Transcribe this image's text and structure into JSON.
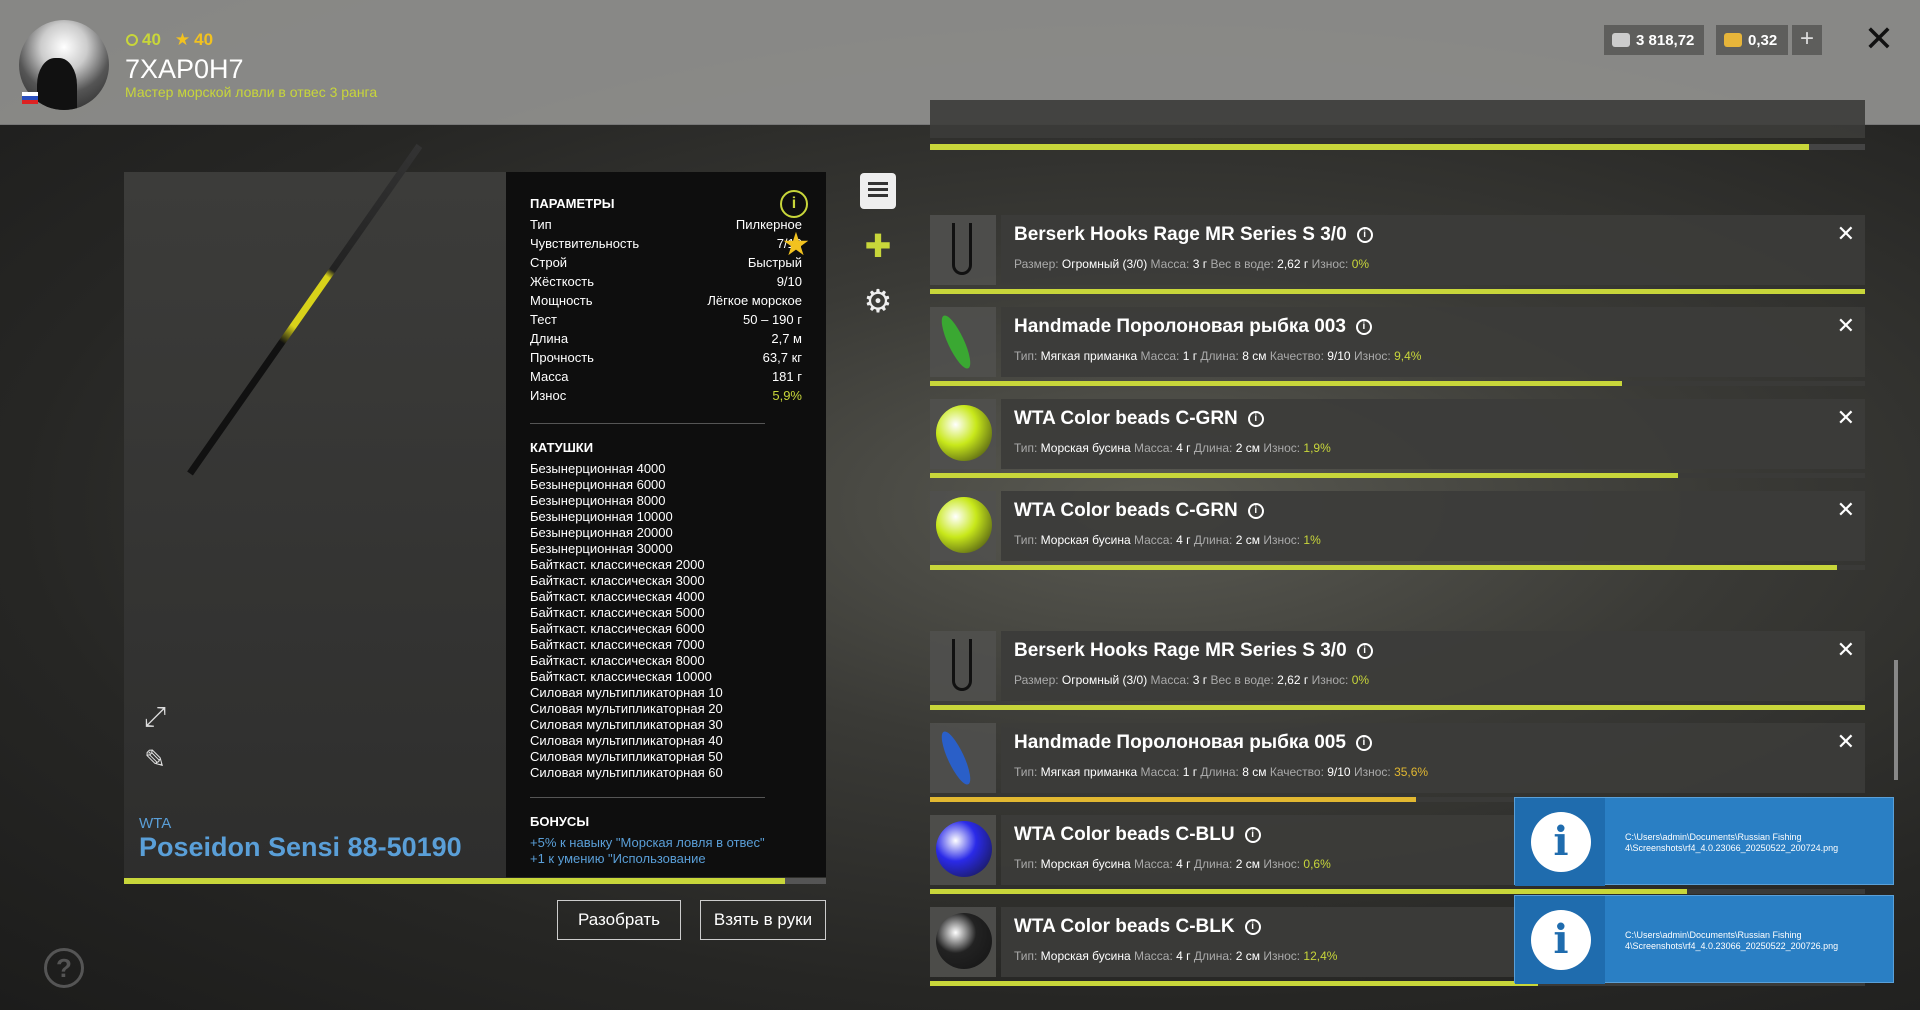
{
  "header": {
    "level_silver": "40",
    "level_gold": "40",
    "player_name": "7XAP0H7",
    "player_rank": "Мастер морской ловли в отвес 3 ранга",
    "silver_amount": "3 818,72",
    "gold_amount": "0,32",
    "plus_label": "+",
    "close_label": "✕"
  },
  "rod": {
    "brand": "WTA",
    "name": "Poseidon Sensi 88-50190",
    "wear_fraction": 0.941,
    "params_title": "ПАРАМЕТРЫ",
    "params": [
      {
        "label": "Тип",
        "value": "Пилкерное"
      },
      {
        "label": "Чувствительность",
        "value": "7/10"
      },
      {
        "label": "Строй",
        "value": "Быстрый"
      },
      {
        "label": "Жёсткость",
        "value": "9/10"
      },
      {
        "label": "Мощность",
        "value": "Лёгкое морское"
      },
      {
        "label": "Тест",
        "value": "50 – 190 г"
      },
      {
        "label": "Длина",
        "value": "2,7 м"
      },
      {
        "label": "Прочность",
        "value": "63,7 кг"
      },
      {
        "label": "Масса",
        "value": "181 г"
      },
      {
        "label": "Износ",
        "value": "5,9%"
      }
    ],
    "reels_title": "КАТУШКИ",
    "reels": [
      "Безынерционная 4000",
      "Безынерционная 6000",
      "Безынерционная 8000",
      "Безынерционная 10000",
      "Безынерционная 20000",
      "Безынерционная 30000",
      "Байткаст. классическая 2000",
      "Байткаст. классическая 3000",
      "Байткаст. классическая 4000",
      "Байткаст. классическая 5000",
      "Байткаст. классическая 6000",
      "Байткаст. классическая 7000",
      "Байткаст. классическая 8000",
      "Байткаст. классическая 10000",
      "Силовая мультипликаторная 10",
      "Силовая мультипликаторная 20",
      "Силовая мультипликаторная 30",
      "Силовая мультипликаторная 40",
      "Силовая мультипликаторная 50",
      "Силовая мультипликаторная 60"
    ],
    "bonuses_title": "БОНУСЫ",
    "bonuses": [
      "+5% к навыку \"Морская ловля в отвес\"",
      "+1 к умению \"Использование"
    ]
  },
  "buttons": {
    "dismantle": "Разобрать",
    "equip": "Взять в руки"
  },
  "top_item": {
    "details": "Тип: Морская бусина  Масса: 4 г  Длина: 2 см  Износ: 0,6%",
    "wear_fraction": 0.94
  },
  "items": [
    {
      "title": "Berserk Hooks Rage MR Series S 3/0",
      "kind": "hook",
      "details": [
        {
          "label": "Размер:",
          "value": "Огромный (3/0)"
        },
        {
          "label": "Масса:",
          "value": "3 г"
        },
        {
          "label": "Вес в воде:",
          "value": "2,62 г"
        },
        {
          "label": "Износ:",
          "value": "0%",
          "wear": true
        }
      ],
      "wear_fraction": 1.0,
      "wear_color": "#c8d63a"
    },
    {
      "title": "Handmade Поролоновая рыбка 003",
      "kind": "lure",
      "lure_color": "#3aa832",
      "details": [
        {
          "label": "Тип:",
          "value": "Мягкая приманка"
        },
        {
          "label": "Масса:",
          "value": "1 г"
        },
        {
          "label": "Длина:",
          "value": "8 см"
        },
        {
          "label": "Качество:",
          "value": "9/10"
        },
        {
          "label": "Износ:",
          "value": "9,4%",
          "wear": true
        }
      ],
      "wear_fraction": 0.74,
      "wear_color": "#c8d63a"
    },
    {
      "title": "WTA Color beads C-GRN",
      "kind": "bead",
      "bead_color": "#c8e81a",
      "details": [
        {
          "label": "Тип:",
          "value": "Морская бусина"
        },
        {
          "label": "Масса:",
          "value": "4 г"
        },
        {
          "label": "Длина:",
          "value": "2 см"
        },
        {
          "label": "Износ:",
          "value": "1,9%",
          "wear": true
        }
      ],
      "wear_fraction": 0.8,
      "wear_color": "#c8d63a"
    },
    {
      "title": "WTA Color beads C-GRN",
      "kind": "bead",
      "bead_color": "#c8e81a",
      "details": [
        {
          "label": "Тип:",
          "value": "Морская бусина"
        },
        {
          "label": "Масса:",
          "value": "4 г"
        },
        {
          "label": "Длина:",
          "value": "2 см"
        },
        {
          "label": "Износ:",
          "value": "1%",
          "wear": true
        }
      ],
      "wear_fraction": 0.97,
      "wear_color": "#c8d63a"
    },
    {
      "title": "Berserk Hooks Rage MR Series S 3/0",
      "kind": "hook",
      "details": [
        {
          "label": "Размер:",
          "value": "Огромный (3/0)"
        },
        {
          "label": "Масса:",
          "value": "3 г"
        },
        {
          "label": "Вес в воде:",
          "value": "2,62 г"
        },
        {
          "label": "Износ:",
          "value": "0%",
          "wear": true
        }
      ],
      "wear_fraction": 1.0,
      "wear_color": "#c8d63a"
    },
    {
      "title": "Handmade Поролоновая рыбка 005",
      "kind": "lure",
      "lure_color": "#2a5fc8",
      "details": [
        {
          "label": "Тип:",
          "value": "Мягкая приманка"
        },
        {
          "label": "Масса:",
          "value": "1 г"
        },
        {
          "label": "Длина:",
          "value": "8 см"
        },
        {
          "label": "Качество:",
          "value": "9/10"
        },
        {
          "label": "Износ:",
          "value": "35,6%",
          "wear": true,
          "warn": true
        }
      ],
      "wear_fraction": 0.52,
      "wear_color": "#e2b831"
    },
    {
      "title": "WTA Color beads C-BLU",
      "kind": "bead",
      "bead_color": "#2a2ae8",
      "details": [
        {
          "label": "Тип:",
          "value": "Морская бусина"
        },
        {
          "label": "Масса:",
          "value": "4 г"
        },
        {
          "label": "Длина:",
          "value": "2 см"
        },
        {
          "label": "Износ:",
          "value": "0,6%",
          "wear": true
        }
      ],
      "wear_fraction": 0.81,
      "wear_color": "#c8d63a"
    },
    {
      "title": "WTA Color beads C-BLK",
      "kind": "bead",
      "bead_color": "#222222",
      "details": [
        {
          "label": "Тип:",
          "value": "Морская бусина"
        },
        {
          "label": "Масса:",
          "value": "4 г"
        },
        {
          "label": "Длина:",
          "value": "2 см"
        },
        {
          "label": "Износ:",
          "value": "12,4%",
          "wear": true
        }
      ],
      "wear_fraction": 0.65,
      "wear_color": "#c8d63a"
    }
  ],
  "toasts": [
    {
      "icon": "info-icon",
      "text": "C:\\Users\\admin\\Documents\\Russian Fishing 4\\Screenshots\\rf4_4.0.23066_20250522_200724.png"
    },
    {
      "icon": "info-icon",
      "text": "C:\\Users\\admin\\Documents\\Russian Fishing 4\\Screenshots\\rf4_4.0.23066_20250522_200726.png"
    }
  ],
  "icons": {
    "accent": "#c8d63a",
    "gold": "#f2c21f",
    "rod_name_color": "#5a9fd8"
  }
}
